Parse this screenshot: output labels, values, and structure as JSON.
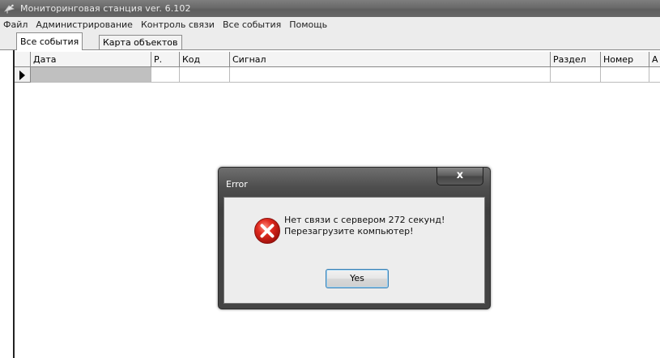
{
  "window": {
    "title": "Мониторинговая станция ver. 6.102"
  },
  "menu": [
    "Файл",
    "Администрирование",
    "Контроль связи",
    "Все события",
    "Помощь"
  ],
  "tabs": {
    "active": "Все события",
    "inactive": "Карта объектов"
  },
  "grid": {
    "columns": [
      "Дата",
      "Р.",
      "Код",
      "Сигнал",
      "Раздел",
      "Номер",
      "А"
    ]
  },
  "dialog": {
    "title": "Error",
    "close_label": "x",
    "message_line1": "Нет связи с сервером 272 секунд!",
    "message_line2": "Перезагрузите компьютер!",
    "button_label": "Yes"
  },
  "colors": {
    "titlebar": "#6a6a6a",
    "error_icon": "#e02a1f",
    "selected_cell": "#c0c0c0"
  },
  "icons": {
    "app": "satellite-dish-icon",
    "dialog": "error-icon"
  }
}
